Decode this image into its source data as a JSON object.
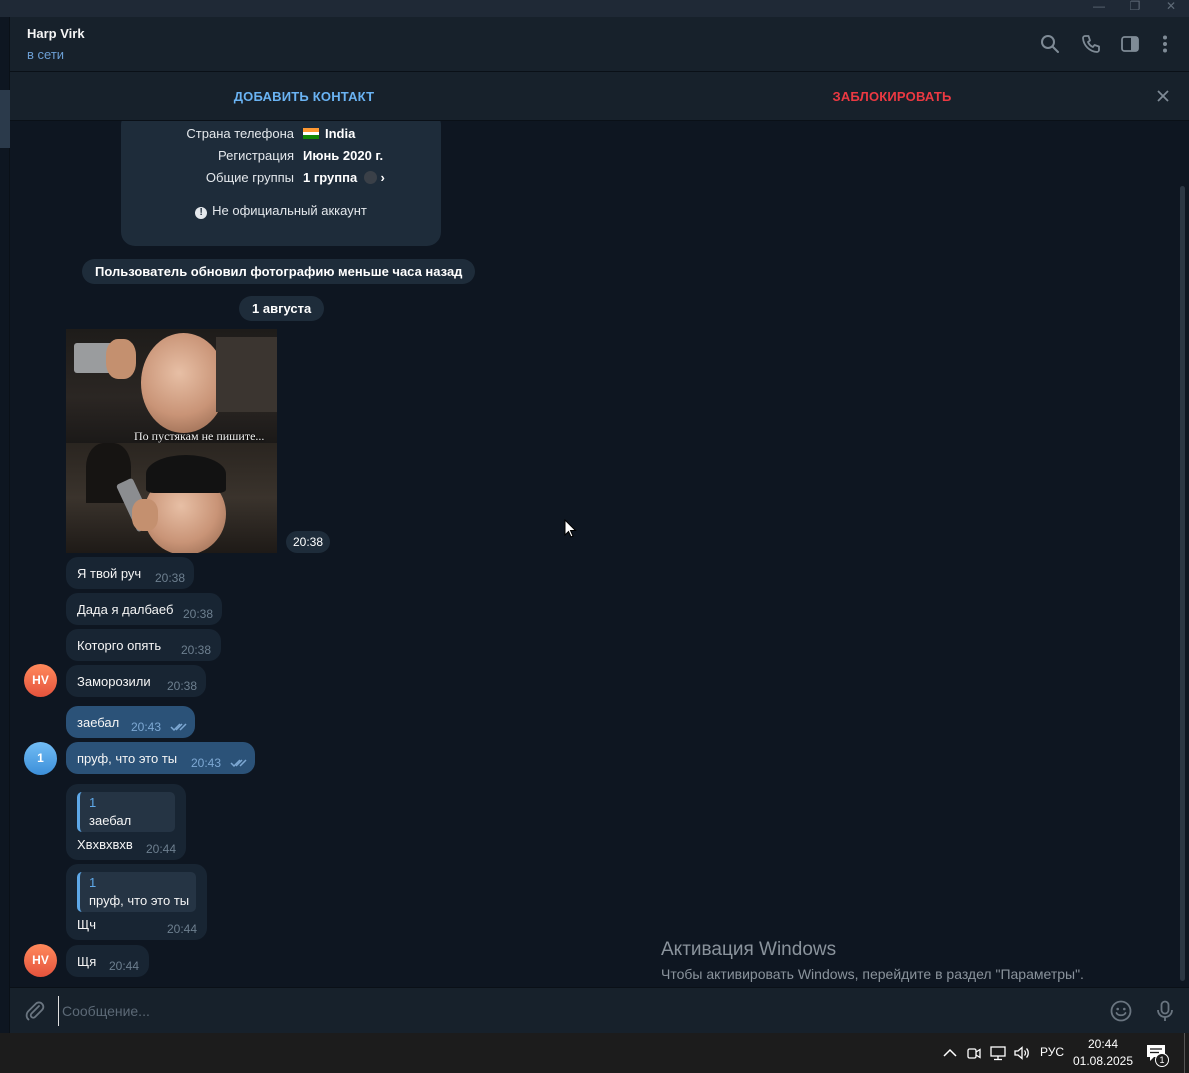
{
  "window": {
    "minimize_glyph": "—",
    "maximize_glyph": "❐",
    "close_glyph": "✕"
  },
  "header": {
    "name": "Harp Virk",
    "status": "в сети",
    "icons": [
      "search-icon",
      "phone-icon",
      "sidebar-toggle-icon",
      "more-vertical-icon"
    ]
  },
  "action_bar": {
    "add_contact": "ДОБАВИТЬ КОНТАКТ",
    "block": "ЗАБЛОКИРОВАТЬ",
    "close_icon": "close-icon"
  },
  "info_card": {
    "rows": [
      {
        "label": "Страна телефона",
        "value": "India",
        "icon": "india-flag-icon"
      },
      {
        "label": "Регистрация",
        "value": "Июнь 2020 г."
      },
      {
        "label": "Общие группы",
        "value": "1 группа",
        "suffix": "›"
      }
    ],
    "note": "Не официальный аккаунт",
    "note_icon": "!"
  },
  "service_message": "Пользователь обновил фотографию меньше часа назад",
  "date_separator": "1 августа",
  "photo": {
    "caption": "По пустякам не пишите...",
    "time": "20:38"
  },
  "messages": [
    {
      "text": "Я твой руч",
      "time": "20:38",
      "direction": "in"
    },
    {
      "text": "Дада я далбаеб",
      "time": "20:38",
      "direction": "in"
    },
    {
      "text": "Которго опять",
      "time": "20:38",
      "direction": "in"
    },
    {
      "text": "Заморозили",
      "time": "20:38",
      "direction": "in",
      "avatar": "HV"
    },
    {
      "text": "заебал",
      "time": "20:43",
      "direction": "out",
      "read": true
    },
    {
      "text": "пруф, что это ты",
      "time": "20:43",
      "direction": "out",
      "read": true,
      "avatar": "1"
    }
  ],
  "replies": [
    {
      "reply_name": "1",
      "reply_text": "заебал",
      "text": "Хвхвхвхв",
      "time": "20:44"
    },
    {
      "reply_name": "1",
      "reply_text": "пруф, что это ты",
      "text": "Щч",
      "time": "20:44"
    }
  ],
  "last_message": {
    "text": "Щя",
    "time": "20:44",
    "avatar": "HV"
  },
  "watermark": {
    "title": "Активация Windows",
    "subtitle": "Чтобы активировать Windows, перейдите в раздел \"Параметры\"."
  },
  "composer": {
    "placeholder": "Сообщение...",
    "value": "",
    "icons": [
      "attach-icon",
      "emoji-icon",
      "microphone-icon"
    ]
  },
  "taskbar": {
    "language": "РУС",
    "time": "20:44",
    "date": "01.08.2025",
    "notification_count": "1",
    "icons": [
      "chevron-up-icon",
      "meet-now-icon",
      "network-icon",
      "volume-icon",
      "notification-icon"
    ]
  },
  "colors": {
    "background": "#0e1621",
    "panel": "#17212b",
    "incoming_bubble": "#182533",
    "outgoing_bubble": "#2b5278",
    "accent": "#6ab3f3",
    "danger": "#ec3942"
  }
}
